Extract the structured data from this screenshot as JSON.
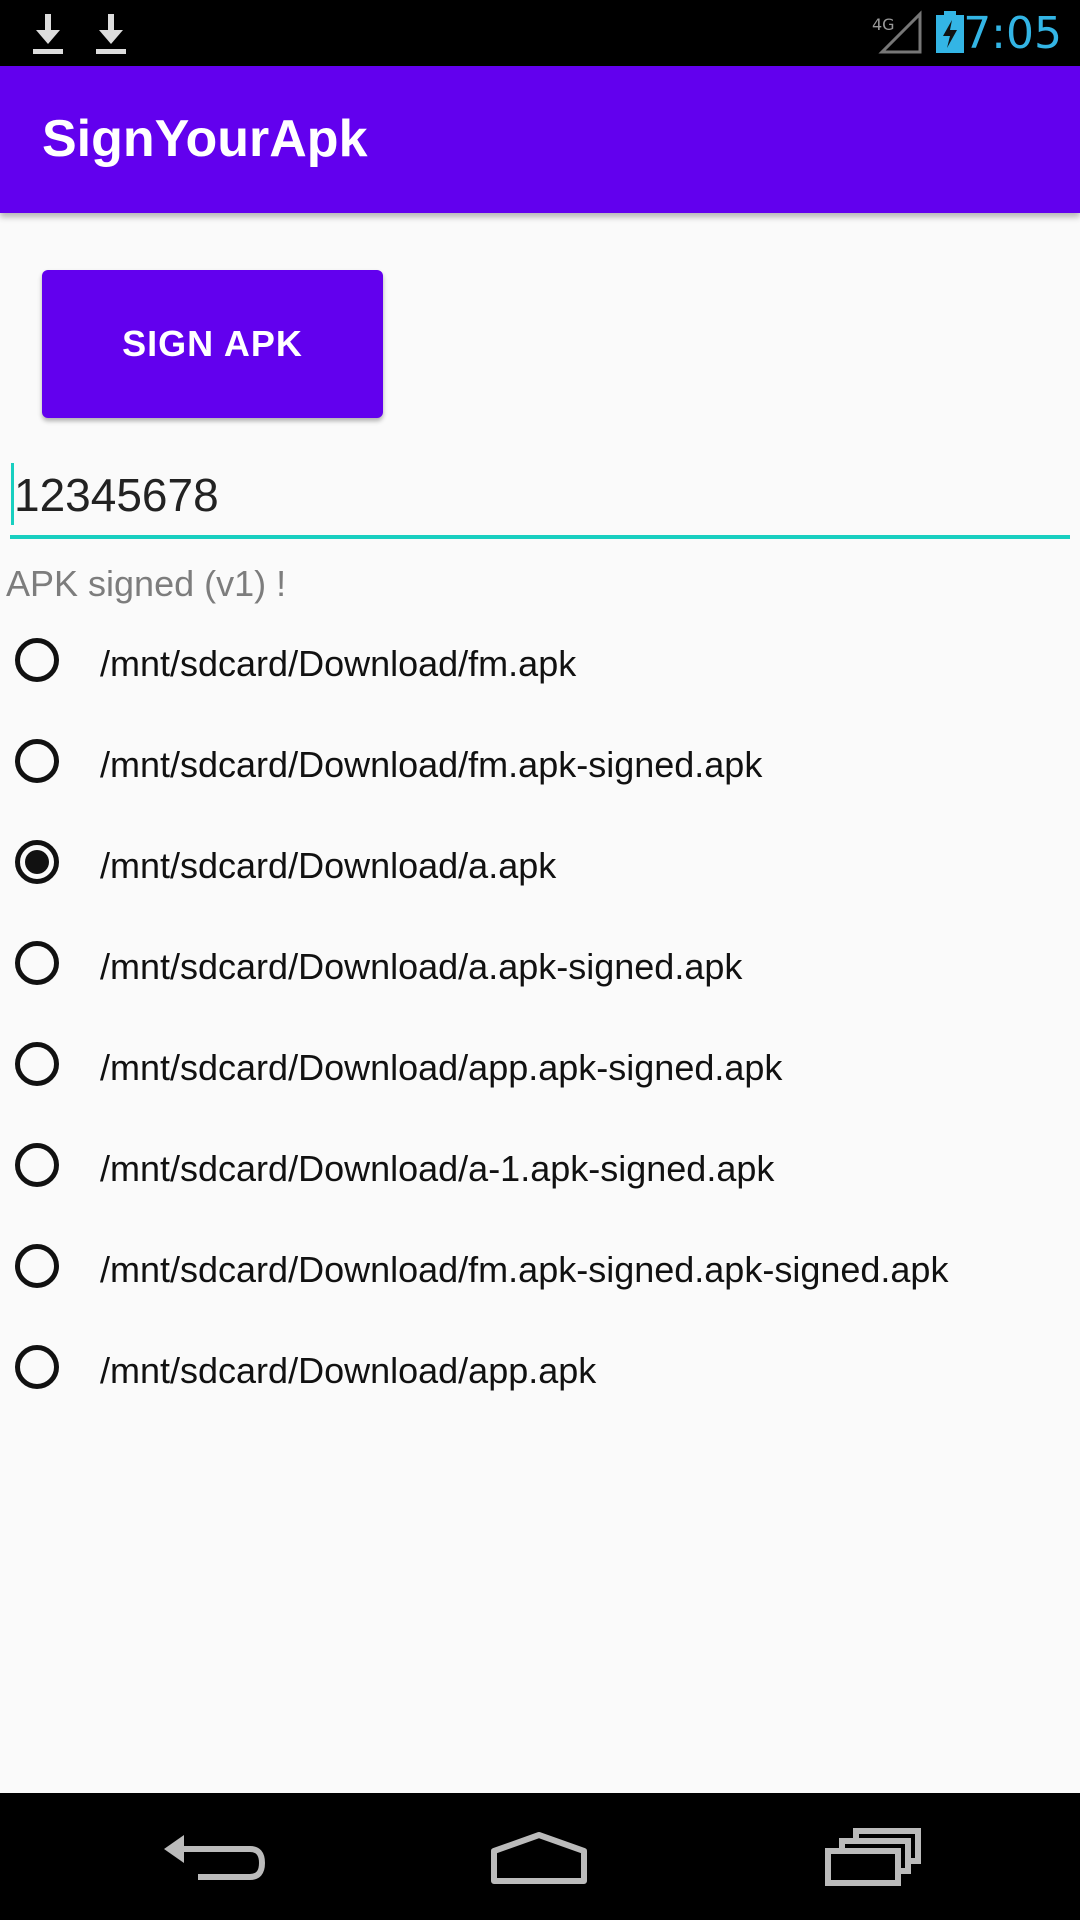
{
  "status_bar": {
    "time": "7:05",
    "network": "4G",
    "icons": [
      "download-icon",
      "download-icon",
      "signal-icon",
      "battery-charging-icon"
    ],
    "clock_color": "#33b5e5"
  },
  "app_bar": {
    "title": "SignYourApk",
    "color": "#6200ee"
  },
  "sign_button": {
    "label": "SIGN APK"
  },
  "password_field": {
    "value": "12345678",
    "accent": "#18cfc0"
  },
  "status_message": "APK signed (v1) !",
  "apk_list": {
    "items": [
      {
        "label": "/mnt/sdcard/Download/fm.apk",
        "checked": false
      },
      {
        "label": "/mnt/sdcard/Download/fm.apk-signed.apk",
        "checked": false
      },
      {
        "label": "/mnt/sdcard/Download/a.apk",
        "checked": true
      },
      {
        "label": "/mnt/sdcard/Download/a.apk-signed.apk",
        "checked": false
      },
      {
        "label": "/mnt/sdcard/Download/app.apk-signed.apk",
        "checked": false
      },
      {
        "label": "/mnt/sdcard/Download/a-1.apk-signed.apk",
        "checked": false
      },
      {
        "label": "/mnt/sdcard/Download/fm.apk-signed.apk-signed.apk",
        "checked": false
      },
      {
        "label": "/mnt/sdcard/Download/app.apk",
        "checked": false
      }
    ]
  },
  "nav_bar": {
    "buttons": [
      "back-icon",
      "home-icon",
      "recents-icon"
    ]
  }
}
